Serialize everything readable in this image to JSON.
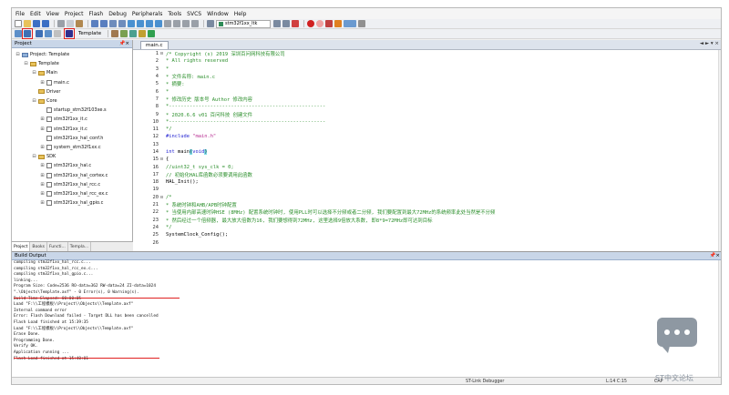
{
  "menu": [
    "File",
    "Edit",
    "View",
    "Project",
    "Flash",
    "Debug",
    "Peripherals",
    "Tools",
    "SVCS",
    "Window",
    "Help"
  ],
  "toolbar": {
    "target_combo": "stm32f1xx_ltk",
    "target_name": "Template",
    "colors": {
      "red_box": "#e02020"
    }
  },
  "project": {
    "title": "Project",
    "tree": [
      {
        "depth": 0,
        "expander": "⊟",
        "icon": "root",
        "label": "Project: Template"
      },
      {
        "depth": 1,
        "expander": "⊟",
        "icon": "folder",
        "label": "Template"
      },
      {
        "depth": 2,
        "expander": "⊟",
        "icon": "folder",
        "label": "Main"
      },
      {
        "depth": 3,
        "expander": "⊞",
        "icon": "file",
        "label": "main.c"
      },
      {
        "depth": 2,
        "expander": "",
        "icon": "folder",
        "label": "Driver"
      },
      {
        "depth": 2,
        "expander": "⊟",
        "icon": "folder",
        "label": "Core"
      },
      {
        "depth": 3,
        "expander": "",
        "icon": "file",
        "label": "startup_stm32f103xe.s"
      },
      {
        "depth": 3,
        "expander": "⊞",
        "icon": "file",
        "label": "stm32f1xx_it.c"
      },
      {
        "depth": 3,
        "expander": "⊞",
        "icon": "file",
        "label": "stm32f1xx_it.c"
      },
      {
        "depth": 3,
        "expander": "",
        "icon": "file",
        "label": "stm32f1xx_hal_conf.h"
      },
      {
        "depth": 3,
        "expander": "⊞",
        "icon": "file",
        "label": "system_stm32f1xx.c"
      },
      {
        "depth": 2,
        "expander": "⊟",
        "icon": "folder",
        "label": "SDK"
      },
      {
        "depth": 3,
        "expander": "⊞",
        "icon": "file",
        "label": "stm32f1xx_hal.c"
      },
      {
        "depth": 3,
        "expander": "⊞",
        "icon": "file",
        "label": "stm32f1xx_hal_cortex.c"
      },
      {
        "depth": 3,
        "expander": "⊞",
        "icon": "file",
        "label": "stm32f1xx_hal_rcc.c"
      },
      {
        "depth": 3,
        "expander": "⊞",
        "icon": "file",
        "label": "stm32f1xx_hal_rcc_ex.c"
      },
      {
        "depth": 3,
        "expander": "⊞",
        "icon": "file",
        "label": "stm32f1xx_hal_gpio.c"
      }
    ],
    "tabs": [
      "Project",
      "Books",
      "Functi...",
      "Templa..."
    ]
  },
  "editor": {
    "active_tab": "main.c",
    "lines": [
      {
        "n": "1",
        "fold": "⊟",
        "parts": [
          {
            "c": "cmt",
            "t": "/*  Copyright (s) 2019 深圳百问网科技有限公司"
          }
        ]
      },
      {
        "n": "2",
        "fold": "",
        "parts": [
          {
            "c": "cmt",
            "t": " *  All rights reserved"
          }
        ]
      },
      {
        "n": "3",
        "fold": "",
        "parts": [
          {
            "c": "cmt",
            "t": " *"
          }
        ]
      },
      {
        "n": "4",
        "fold": "",
        "parts": [
          {
            "c": "cmt",
            "t": " * 文件名称: main.c"
          }
        ]
      },
      {
        "n": "5",
        "fold": "",
        "parts": [
          {
            "c": "cmt",
            "t": " * 摘要:"
          }
        ]
      },
      {
        "n": "6",
        "fold": "",
        "parts": [
          {
            "c": "cmt",
            "t": " *"
          }
        ]
      },
      {
        "n": "7",
        "fold": "",
        "parts": [
          {
            "c": "cmt",
            "t": " * 修改历史     版本号       Author       修改内容"
          }
        ]
      },
      {
        "n": "8",
        "fold": "",
        "parts": [
          {
            "c": "cmt",
            "t": " *-----------------------------------------------------"
          }
        ]
      },
      {
        "n": "9",
        "fold": "",
        "parts": [
          {
            "c": "cmt",
            "t": " * 2020.6.6      v01         百问科技       创建文件"
          }
        ]
      },
      {
        "n": "10",
        "fold": "",
        "parts": [
          {
            "c": "cmt",
            "t": " *-----------------------------------------------------"
          }
        ]
      },
      {
        "n": "11",
        "fold": "",
        "parts": [
          {
            "c": "cmt",
            "t": " */"
          }
        ]
      },
      {
        "n": "12",
        "fold": "",
        "parts": [
          {
            "c": "kw",
            "t": "#include "
          },
          {
            "c": "str",
            "t": "\"main.h\""
          }
        ]
      },
      {
        "n": "13",
        "fold": "",
        "parts": []
      },
      {
        "n": "14",
        "fold": "",
        "parts": [
          {
            "c": "kw",
            "t": "int"
          },
          {
            "c": "ct",
            "t": " main"
          },
          {
            "c": "hl",
            "t": "("
          },
          {
            "c": "kw",
            "t": "void"
          },
          {
            "c": "hl",
            "t": ")"
          }
        ]
      },
      {
        "n": "15",
        "fold": "⊟",
        "parts": [
          {
            "c": "ct",
            "t": "{"
          }
        ]
      },
      {
        "n": "16",
        "fold": "",
        "parts": [
          {
            "c": "cmt",
            "t": "    //uint32_t sys_clk = 0;"
          }
        ]
      },
      {
        "n": "17",
        "fold": "",
        "parts": [
          {
            "c": "cmt",
            "t": "    // 初始化HAL库函数必须要调用此函数"
          }
        ]
      },
      {
        "n": "18",
        "fold": "",
        "parts": [
          {
            "c": "ct",
            "t": "    HAL_Init();"
          }
        ]
      },
      {
        "n": "19",
        "fold": "",
        "parts": []
      },
      {
        "n": "20",
        "fold": "⊟",
        "parts": [
          {
            "c": "cmt",
            "t": "    /*"
          }
        ]
      },
      {
        "n": "21",
        "fold": "",
        "parts": [
          {
            "c": "cmt",
            "t": "     * 系统时钟和AHB/APB时钟配置"
          }
        ]
      },
      {
        "n": "22",
        "fold": "",
        "parts": [
          {
            "c": "cmt",
            "t": "     * 当使用内部高速时钟HSE (8MHz) 配置系统时钟时, 使用PLL时可以选择不分频或者二分频, 我们要配置到最大72MHz的系统频率此处当然是不分频"
          }
        ]
      },
      {
        "n": "23",
        "fold": "",
        "parts": [
          {
            "c": "cmt",
            "t": "     * 然后经过一个倍频器, 最大放大倍数为16, 我们要想得到72MHz, 这里选择9倍放大系数, 即8*9=72MHz即可达到目标"
          }
        ]
      },
      {
        "n": "24",
        "fold": "",
        "parts": [
          {
            "c": "cmt",
            "t": "     */"
          }
        ]
      },
      {
        "n": "25",
        "fold": "",
        "parts": [
          {
            "c": "ct",
            "t": "    SystemClock_Config();"
          }
        ]
      },
      {
        "n": "26",
        "fold": "",
        "parts": []
      }
    ]
  },
  "build": {
    "title": "Build Output",
    "lines": [
      "compiling stm32f1xx_hal_rcc.c...",
      "compiling stm32f1xx_hal_rcc_ex.c...",
      "compiling stm32f1xx_hal_gpio.c...",
      "linking...",
      "Program Size: Code=2536 RO-data=362 RW-data=24 ZI-data=1024",
      "\".\\Objects\\Template.axf\" - 0 Error(s), 0 Warning(s).",
      "Build Time Elapsed:  00:00:05",
      "Load \"F:\\\\工程模板\\\\Project\\\\Objects\\\\Template.axf\"",
      "Internal command error",
      "Error: Flash Download failed  -  Target DLL has been cancelled",
      "Flash Load finished at 15:39:35",
      "Load \"F:\\\\工程模板\\\\Project\\\\Objects\\\\Template.axf\"",
      "Erase Done.",
      "Programming Done.",
      "Verify OK.",
      "Application running ...",
      "Flash Load finished at 15:40:01"
    ]
  },
  "status": {
    "debugger": "ST-Link Debugger",
    "position": "L:14 C:15",
    "caps": "CAP"
  },
  "watermark": {
    "text": "ST中文论坛"
  }
}
